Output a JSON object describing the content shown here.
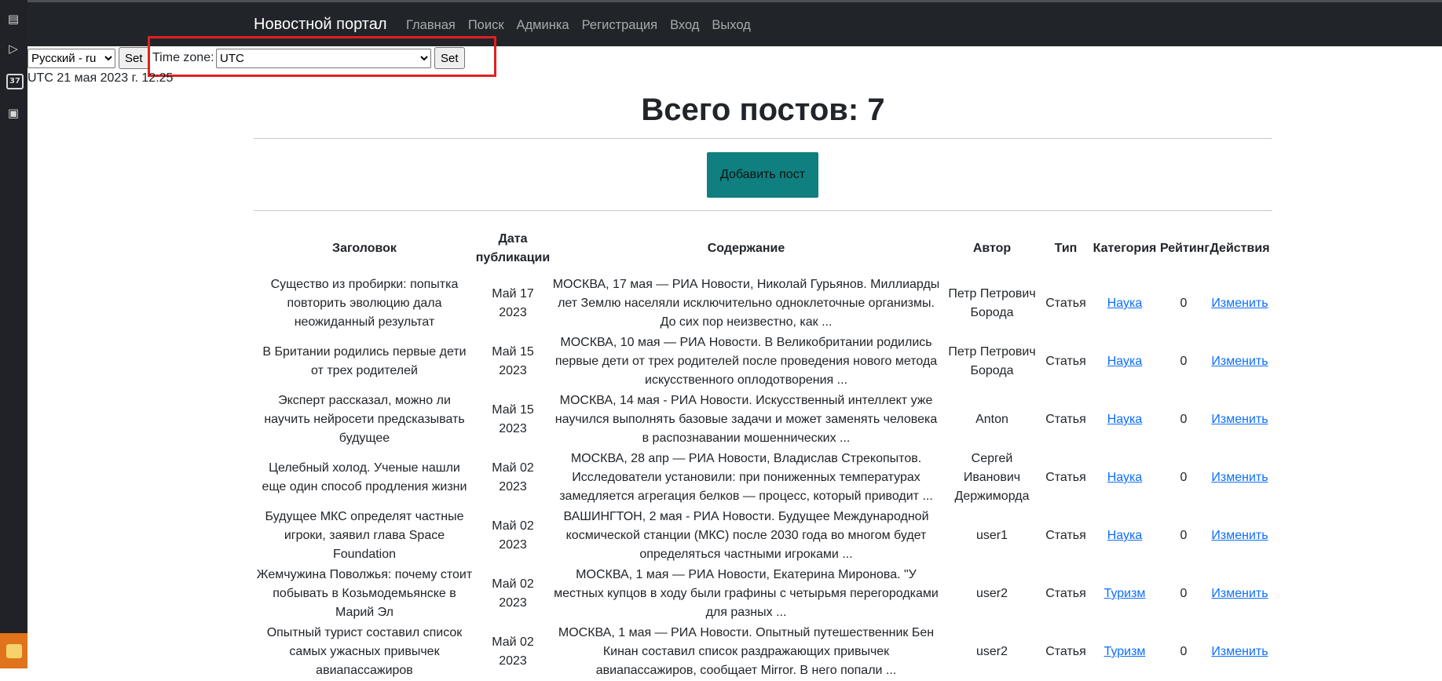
{
  "rail": {
    "icons": [
      "notes-icon",
      "play-icon",
      "calendar-icon",
      "camera-icon",
      "app-icon"
    ],
    "calendar_badge": "37"
  },
  "navbar": {
    "brand": "Новостной портал",
    "links": [
      "Главная",
      "Поиск",
      "Админка",
      "Регистрация",
      "Вход",
      "Выход"
    ]
  },
  "locale": {
    "language_value": "Русский - ru",
    "set_label": "Set",
    "timezone_label": "Time zone:",
    "timezone_value": "UTC",
    "current_time": "UTC 21 мая 2023 г. 12:25"
  },
  "page": {
    "title": "Всего постов: 7",
    "add_post_label": "Добавить пост"
  },
  "table": {
    "headers": [
      "Заголовок",
      "Дата публикации",
      "Содержание",
      "Автор",
      "Тип",
      "Категория",
      "Рейтинг",
      "Действия"
    ],
    "rows": [
      {
        "title": "Существо из пробирки: попытка повторить эволюцию дала неожиданный результат",
        "date": "Май 17 2023",
        "content": "МОСКВА, 17 мая — РИА Новости, Николай Гурьянов. Миллиарды лет Землю населяли исключительно одноклеточные организмы. До сих пор неизвестно, как ...",
        "author": "Петр Петрович Борода",
        "type": "Статья",
        "category": "Наука",
        "rating": "0",
        "action": "Изменить"
      },
      {
        "title": "В Британии родились первые дети от трех родителей",
        "date": "Май 15 2023",
        "content": "МОСКВА, 10 мая — РИА Новости. В Великобритании родились первые дети от трех родителей после проведения нового метода искусственного оплодотворения ...",
        "author": "Петр Петрович Борода",
        "type": "Статья",
        "category": "Наука",
        "rating": "0",
        "action": "Изменить"
      },
      {
        "title": "Эксперт рассказал, можно ли научить нейросети предсказывать будущее",
        "date": "Май 15 2023",
        "content": "МОСКВА, 14 мая - РИА Новости. Искусственный интеллект уже научился выполнять базовые задачи и может заменять человека в распознавании мошеннических ...",
        "author": "Anton",
        "type": "Статья",
        "category": "Наука",
        "rating": "0",
        "action": "Изменить"
      },
      {
        "title": "Целебный холод. Ученые нашли еще один способ продления жизни",
        "date": "Май 02 2023",
        "content": "МОСКВА, 28 апр — РИА Новости, Владислав Стрекопытов. Исследователи установили: при пониженных температурах замедляется агрегация белков — процесс, который приводит ...",
        "author": "Сергей Иванович Держиморда",
        "type": "Статья",
        "category": "Наука",
        "rating": "0",
        "action": "Изменить"
      },
      {
        "title": "Будущее МКС определят частные игроки, заявил глава Space Foundation",
        "date": "Май 02 2023",
        "content": "ВАШИНГТОН, 2 мая - РИА Новости. Будущее Международной космической станции (МКС) после 2030 года во многом будет определяться частными игроками ...",
        "author": "user1",
        "type": "Статья",
        "category": "Наука",
        "rating": "0",
        "action": "Изменить"
      },
      {
        "title": "Жемчужина Поволжья: почему стоит побывать в Козьмодемьянске в Марий Эл",
        "date": "Май 02 2023",
        "content": "МОСКВА, 1 мая — РИА Новости, Екатерина Миронова. \"У местных купцов в ходу были графины с четырьмя перегородками для разных ...",
        "author": "user2",
        "type": "Статья",
        "category": "Туризм",
        "rating": "0",
        "action": "Изменить"
      },
      {
        "title": "Опытный турист составил список самых ужасных привычек авиапассажиров",
        "date": "Май 02 2023",
        "content": "МОСКВА, 1 мая — РИА Новости. Опытный путешественник Бен Кинан составил список раздражающих привычек авиапассажиров, сообщает Mirror. В него попали ...",
        "author": "user2",
        "type": "Статья",
        "category": "Туризм",
        "rating": "0",
        "action": "Изменить"
      }
    ]
  }
}
